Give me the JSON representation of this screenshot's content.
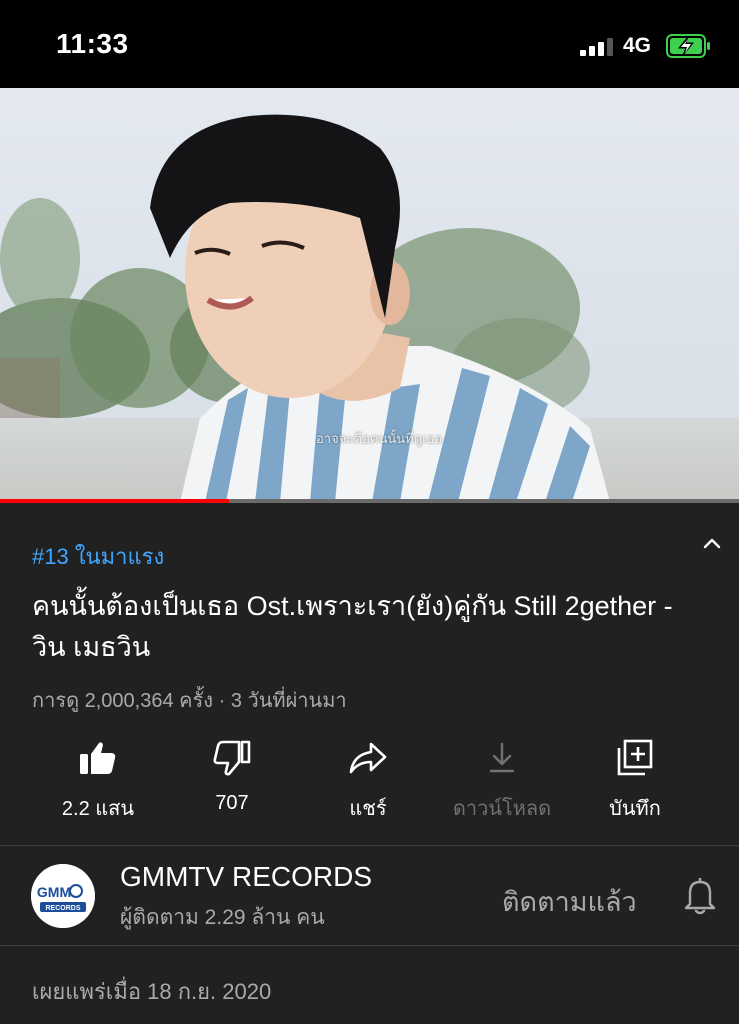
{
  "status_bar": {
    "time": "11:33",
    "network": "4G"
  },
  "video": {
    "subtitle_text": "อาจจะคือคนนั้นที่ดูเธอ",
    "progress": 0.31
  },
  "trending_label": "#13 ในมาแรง",
  "title": "คนนั้นต้องเป็นเธอ Ost.เพราะเรา(ยัง)คู่กัน Still 2gether - วิน เมธวิน",
  "meta": "การดู 2,000,364 ครั้ง · 3 วันที่ผ่านมา",
  "actions": {
    "like": "2.2 แสน",
    "dislike": "707",
    "share": "แชร์",
    "download": "ดาวน์โหลด",
    "save": "บันทึก"
  },
  "channel": {
    "name": "GMMTV RECORDS",
    "subscribers": "ผู้ติดตาม 2.29 ล้าน คน",
    "subscribe_state": "ติดตามแล้ว",
    "logo_text": "GMM",
    "logo_subtext": "RECORDS"
  },
  "published": "เผยแพร่เมื่อ 18 ก.ย. 2020"
}
